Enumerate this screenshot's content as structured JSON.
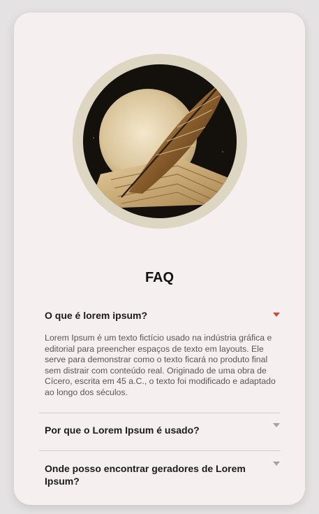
{
  "colors": {
    "page_background": "#e4e2e2",
    "card_background": "#f5efef",
    "accent_caret": "#d9452f",
    "muted_caret": "#a6a2a2",
    "image_ring": "#ddd6c2"
  },
  "hero_image": {
    "icon": "quill-feather-on-parchment-illustration"
  },
  "faq": {
    "title": "FAQ",
    "items": [
      {
        "question": "O que é lorem ipsum?",
        "answer": "Lorem Ipsum é um texto fictício usado na indústria gráfica e editorial para preencher espaços de texto em layouts. Ele serve para demonstrar como o texto ficará no produto final sem distrair com conteúdo real. Originado de uma obra de Cícero, escrita em 45 a.C., o texto foi modificado e adaptado ao longo dos séculos.",
        "expanded": true
      },
      {
        "question": "Por que o Lorem Ipsum é usado?",
        "expanded": false
      },
      {
        "question": "Onde posso encontrar geradores de Lorem Ipsum?",
        "expanded": false
      }
    ]
  }
}
